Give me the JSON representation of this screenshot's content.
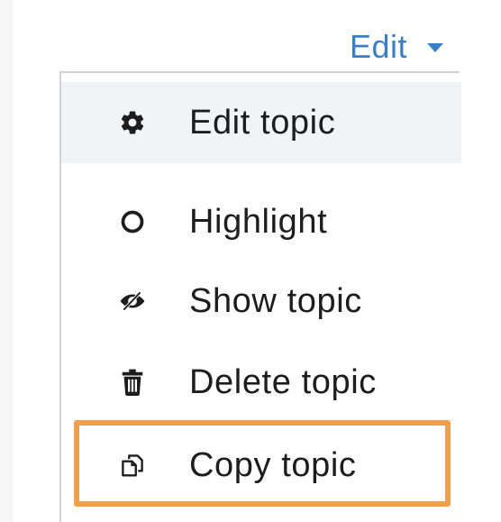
{
  "edit_toggle": {
    "label": "Edit",
    "accent_color": "#3b7fc4"
  },
  "menu": {
    "items": [
      {
        "label": "Edit topic",
        "icon": "gear-icon",
        "active": true
      },
      {
        "label": "Highlight",
        "icon": "circle-outline-icon",
        "active": false
      },
      {
        "label": "Show topic",
        "icon": "eye-slash-icon",
        "active": false
      },
      {
        "label": "Delete topic",
        "icon": "trash-icon",
        "active": false
      },
      {
        "label": "Copy topic",
        "icon": "copy-icon",
        "active": false
      }
    ]
  },
  "highlight_frame": {
    "target": "Copy topic",
    "color": "#f0a04b"
  }
}
